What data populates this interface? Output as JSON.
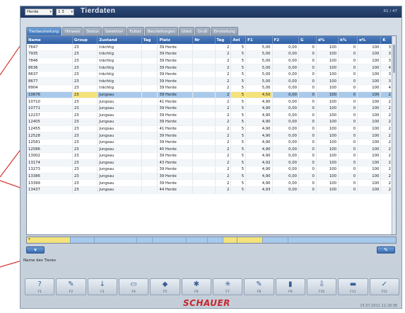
{
  "titlebar": {
    "combo1": "Herde",
    "combo2": "1 3",
    "title": "Tierdaten",
    "right_text": "61 / 47"
  },
  "tabs": [
    {
      "label": "Tierbeurteilung",
      "active": true
    },
    {
      "label": "Hinweis",
      "active": false
    },
    {
      "label": "Status",
      "active": false
    },
    {
      "label": "Selektion",
      "active": false
    },
    {
      "label": "Futter",
      "active": false
    },
    {
      "label": "Beurteilungen",
      "active": false
    },
    {
      "label": "Glied",
      "active": false
    },
    {
      "label": "Gruß",
      "active": false
    },
    {
      "label": "Einstellung",
      "active": false
    }
  ],
  "table": {
    "columns": [
      "Name",
      "Group",
      "Zustand",
      "Tag",
      "Platz",
      "Nr",
      "Tag",
      "Anl",
      "F1",
      "F2",
      "G",
      "d%",
      "k%",
      "e%",
      "K"
    ],
    "rows": [
      [
        "7647",
        "23",
        "trächtig",
        "",
        "39 Herde",
        "",
        "2",
        "5",
        "5,00",
        "0,00",
        "0",
        "100",
        "0",
        "100",
        "3"
      ],
      [
        "7935",
        "23",
        "trächtig",
        "",
        "39 Herde",
        "",
        "2",
        "5",
        "5,00",
        "0,00",
        "0",
        "100",
        "0",
        "100",
        "3"
      ],
      [
        "7846",
        "23",
        "trächtig",
        "",
        "39 Herde",
        "",
        "2",
        "5",
        "5,00",
        "0,00",
        "0",
        "100",
        "0",
        "100",
        "3"
      ],
      [
        "8636",
        "23",
        "trächtig",
        "",
        "39 Herde",
        "",
        "2",
        "5",
        "5,00",
        "0,00",
        "0",
        "100",
        "0",
        "100",
        "4"
      ],
      [
        "8637",
        "23",
        "trächtig",
        "",
        "39 Herde",
        "",
        "2",
        "5",
        "5,00",
        "0,00",
        "0",
        "100",
        "0",
        "100",
        "3"
      ],
      [
        "8677",
        "23",
        "trächtig",
        "",
        "39 Herde",
        "",
        "2",
        "5",
        "5,00",
        "0,00",
        "0",
        "100",
        "0",
        "100",
        "3"
      ],
      [
        "8904",
        "23",
        "trächtig",
        "",
        "39 Herde",
        "",
        "2",
        "5",
        "5,00",
        "0,00",
        "0",
        "100",
        "0",
        "100",
        "4"
      ],
      [
        "10676",
        "23",
        "Jungsau",
        "",
        "39 Herde",
        "",
        "2",
        "5",
        "4,50",
        "0,00",
        "0",
        "100",
        "0",
        "100",
        "2"
      ],
      [
        "10710",
        "23",
        "Jungsau",
        "",
        "41 Herde",
        "",
        "2",
        "5",
        "4,90",
        "0,00",
        "0",
        "100",
        "0",
        "100",
        "2"
      ],
      [
        "10771",
        "23",
        "Jungsau",
        "",
        "39 Herde",
        "",
        "2",
        "5",
        "4,90",
        "0,00",
        "0",
        "100",
        "0",
        "100",
        "2"
      ],
      [
        "12237",
        "23",
        "Jungsau",
        "",
        "39 Herde",
        "",
        "2",
        "5",
        "4,90",
        "0,00",
        "0",
        "100",
        "0",
        "100",
        "2"
      ],
      [
        "12405",
        "23",
        "Jungsau",
        "",
        "39 Herde",
        "",
        "2",
        "5",
        "4,90",
        "0,00",
        "0",
        "100",
        "0",
        "100",
        "2"
      ],
      [
        "12455",
        "23",
        "Jungsau",
        "",
        "41 Herde",
        "",
        "2",
        "5",
        "4,90",
        "0,00",
        "0",
        "100",
        "0",
        "100",
        "2"
      ],
      [
        "12528",
        "23",
        "Jungsau",
        "",
        "39 Herde",
        "",
        "2",
        "5",
        "4,90",
        "0,00",
        "0",
        "100",
        "0",
        "100",
        "2"
      ],
      [
        "12581",
        "23",
        "Jungsau",
        "",
        "39 Herde",
        "",
        "2",
        "5",
        "4,90",
        "0,00",
        "0",
        "100",
        "0",
        "100",
        "2"
      ],
      [
        "12586",
        "23",
        "Jungsau",
        "",
        "40 Herde",
        "",
        "2",
        "5",
        "4,90",
        "0,00",
        "0",
        "100",
        "0",
        "100",
        "2"
      ],
      [
        "13002",
        "23",
        "Jungsau",
        "",
        "39 Herde",
        "",
        "2",
        "5",
        "4,90",
        "0,00",
        "0",
        "100",
        "0",
        "100",
        "2"
      ],
      [
        "13174",
        "23",
        "Jungsau",
        "",
        "43 Herde",
        "",
        "2",
        "5",
        "4,92",
        "0,00",
        "0",
        "100",
        "0",
        "100",
        "2"
      ],
      [
        "13273",
        "23",
        "Jungsau",
        "",
        "39 Herde",
        "",
        "2",
        "5",
        "4,90",
        "0,00",
        "0",
        "100",
        "0",
        "100",
        "2"
      ],
      [
        "13386",
        "23",
        "Jungsau",
        "",
        "39 Herde",
        "",
        "2",
        "5",
        "4,90",
        "0,00",
        "0",
        "100",
        "0",
        "100",
        "2"
      ],
      [
        "13399",
        "23",
        "Jungsau",
        "",
        "39 Herde",
        "",
        "2",
        "5",
        "4,90",
        "0,00",
        "0",
        "100",
        "0",
        "100",
        "2"
      ],
      [
        "13437",
        "23",
        "Jungsau",
        "",
        "44 Herde",
        "",
        "2",
        "5",
        "4,93",
        "0,00",
        "0",
        "100",
        "0",
        "100",
        "2"
      ]
    ],
    "selected_row_index": 7,
    "highlighted_column_indexes": [
      1,
      7,
      8
    ]
  },
  "edit_row": {
    "first_value": "*"
  },
  "status_text": "Name des Tieres",
  "fkeys": [
    {
      "icon": "help-icon",
      "glyph": "?",
      "label": "F1"
    },
    {
      "icon": "note-icon",
      "glyph": "✎",
      "label": "F2"
    },
    {
      "icon": "pig-down-icon",
      "glyph": "↓",
      "label": "F3"
    },
    {
      "icon": "blank-icon",
      "glyph": "▭",
      "label": "F4"
    },
    {
      "icon": "pig-icon",
      "glyph": "◆",
      "label": "F5"
    },
    {
      "icon": "pig-star-icon",
      "glyph": "✱",
      "label": "F6"
    },
    {
      "icon": "pig-cross-icon",
      "glyph": "✳",
      "label": "F7"
    },
    {
      "icon": "pig-edit-icon",
      "glyph": "✎",
      "label": "F8"
    },
    {
      "icon": "print-icon",
      "glyph": "▮",
      "label": "F9"
    },
    {
      "icon": "import-icon",
      "glyph": "⇩",
      "label": "F10"
    },
    {
      "icon": "blank-icon",
      "glyph": "▬",
      "label": "F11"
    },
    {
      "icon": "check-icon",
      "glyph": "✓",
      "label": "F12"
    }
  ],
  "footer": {
    "left": "",
    "logo": "SCHAUER",
    "right": "15.07.2011 11:18:38"
  },
  "colors": {
    "title_bar": "#1d355e",
    "header": "#2f5fa4",
    "selected_row": "#a9c9ea",
    "highlight": "#f4e27a",
    "logo": "#c8262c",
    "callout": "#d42020"
  }
}
